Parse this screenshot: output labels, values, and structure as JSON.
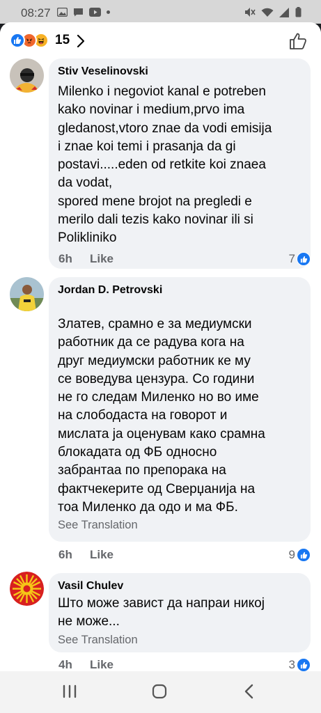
{
  "status_bar": {
    "time": "08:27"
  },
  "reactions_header": {
    "count": "15",
    "icons": [
      "like-icon",
      "angry-icon",
      "haha-icon"
    ]
  },
  "comments": [
    {
      "author": "Stiv Veselinovski",
      "text": "Milenko i negoviot kanal  e potreben\nkako novinar i medium,prvo ima\ngledanost,vtoro znae da vodi emisija\ni znae koi temi i prasanja da gi\npostavi.....eden od retkite koi znaea\nda vodat,\nspored mene brojot na pregledi e\nmerilo dali tezis kako novinar  ili si\nPolikliniko",
      "time": "6h",
      "like_label": "Like",
      "likes": "7"
    },
    {
      "author": "Jordan D. Petrovski",
      "text": "Златев, срамно е за медиумски\nработник да се радува кога на\nдруг медиумски работник ке му\nсе воведува цензура. Со години\nне го следам Миленко но во име\nна слободаста на говорот и\nмислата ја оценувам како срамна\nблокадата од ФБ односно\nзабрантаа по препорака на\nфактчекерите од Сверџанија на\nтоа Миленко да одо и ма ФБ.",
      "translation": "See Translation",
      "time": "6h",
      "like_label": "Like",
      "likes": "9"
    },
    {
      "author": "Vasil Chulev",
      "text": "Што може завист да напраи никој\nне може...",
      "translation": "See Translation",
      "time": "4h",
      "like_label": "Like",
      "likes": "3"
    }
  ],
  "colors": {
    "accent": "#1877f2",
    "bubble": "#f0f2f5",
    "meta_text": "#65676b"
  }
}
